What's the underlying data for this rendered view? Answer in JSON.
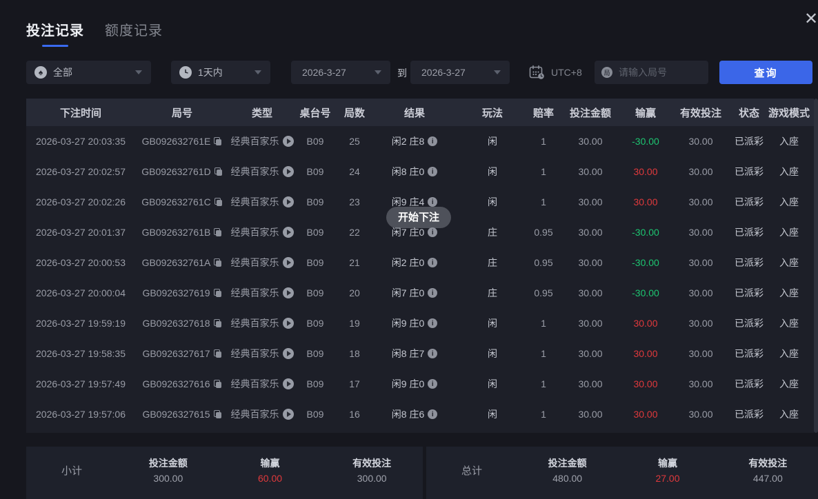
{
  "window": {
    "close_icon": "✕"
  },
  "tabs": [
    {
      "label": "投注记录",
      "active": true
    },
    {
      "label": "额度记录",
      "active": false
    }
  ],
  "filters": {
    "game_type": {
      "value": "全部",
      "icon_glyph": "♠"
    },
    "time_range": {
      "value": "1天内"
    },
    "date_from": "2026-3-27",
    "to_label": "到",
    "date_to": "2026-3-27",
    "timezone": "UTC+8",
    "round_placeholder": "请输入局号",
    "round_icon_label": "局",
    "query_label": "查询"
  },
  "table": {
    "headers": [
      "下注时间",
      "局号",
      "类型",
      "桌台号",
      "局数",
      "结果",
      "玩法",
      "赔率",
      "投注金额",
      "输赢",
      "有效投注",
      "状态",
      "游戏模式"
    ],
    "rows": [
      {
        "time": "2026-03-27 20:03:35",
        "round_id": "GB092632761E",
        "type": "经典百家乐",
        "table_no": "B09",
        "round": "25",
        "result": "闲2 庄8",
        "play": "闲",
        "odds": "1",
        "bet": "30.00",
        "winloss": "-30.00",
        "valid": "30.00",
        "status": "已派彩",
        "mode": "入座"
      },
      {
        "time": "2026-03-27 20:02:57",
        "round_id": "GB092632761D",
        "type": "经典百家乐",
        "table_no": "B09",
        "round": "24",
        "result": "闲8 庄0",
        "play": "闲",
        "odds": "1",
        "bet": "30.00",
        "winloss": "30.00",
        "valid": "30.00",
        "status": "已派彩",
        "mode": "入座"
      },
      {
        "time": "2026-03-27 20:02:26",
        "round_id": "GB092632761C",
        "type": "经典百家乐",
        "table_no": "B09",
        "round": "23",
        "result": "闲9 庄4",
        "play": "闲",
        "odds": "1",
        "bet": "30.00",
        "winloss": "30.00",
        "valid": "30.00",
        "status": "已派彩",
        "mode": "入座"
      },
      {
        "time": "2026-03-27 20:01:37",
        "round_id": "GB092632761B",
        "type": "经典百家乐",
        "table_no": "B09",
        "round": "22",
        "result": "闲7 庄0",
        "play": "庄",
        "odds": "0.95",
        "bet": "30.00",
        "winloss": "-30.00",
        "valid": "30.00",
        "status": "已派彩",
        "mode": "入座"
      },
      {
        "time": "2026-03-27 20:00:53",
        "round_id": "GB092632761A",
        "type": "经典百家乐",
        "table_no": "B09",
        "round": "21",
        "result": "闲2 庄0",
        "play": "庄",
        "odds": "0.95",
        "bet": "30.00",
        "winloss": "-30.00",
        "valid": "30.00",
        "status": "已派彩",
        "mode": "入座"
      },
      {
        "time": "2026-03-27 20:00:04",
        "round_id": "GB0926327619",
        "type": "经典百家乐",
        "table_no": "B09",
        "round": "20",
        "result": "闲7 庄0",
        "play": "庄",
        "odds": "0.95",
        "bet": "30.00",
        "winloss": "-30.00",
        "valid": "30.00",
        "status": "已派彩",
        "mode": "入座"
      },
      {
        "time": "2026-03-27 19:59:19",
        "round_id": "GB0926327618",
        "type": "经典百家乐",
        "table_no": "B09",
        "round": "19",
        "result": "闲9 庄0",
        "play": "闲",
        "odds": "1",
        "bet": "30.00",
        "winloss": "30.00",
        "valid": "30.00",
        "status": "已派彩",
        "mode": "入座"
      },
      {
        "time": "2026-03-27 19:58:35",
        "round_id": "GB0926327617",
        "type": "经典百家乐",
        "table_no": "B09",
        "round": "18",
        "result": "闲8 庄7",
        "play": "闲",
        "odds": "1",
        "bet": "30.00",
        "winloss": "30.00",
        "valid": "30.00",
        "status": "已派彩",
        "mode": "入座"
      },
      {
        "time": "2026-03-27 19:57:49",
        "round_id": "GB0926327616",
        "type": "经典百家乐",
        "table_no": "B09",
        "round": "17",
        "result": "闲9 庄0",
        "play": "闲",
        "odds": "1",
        "bet": "30.00",
        "winloss": "30.00",
        "valid": "30.00",
        "status": "已派彩",
        "mode": "入座"
      },
      {
        "time": "2026-03-27 19:57:06",
        "round_id": "GB0926327615",
        "type": "经典百家乐",
        "table_no": "B09",
        "round": "16",
        "result": "闲8 庄6",
        "play": "闲",
        "odds": "1",
        "bet": "30.00",
        "winloss": "30.00",
        "valid": "30.00",
        "status": "已派彩",
        "mode": "入座"
      }
    ]
  },
  "toast": {
    "label": "开始下注"
  },
  "summary": {
    "subtotal": {
      "label": "小计",
      "items": [
        {
          "name": "投注金额",
          "value": "300.00",
          "color": "plain"
        },
        {
          "name": "输赢",
          "value": "60.00",
          "color": "red"
        },
        {
          "name": "有效投注",
          "value": "300.00",
          "color": "plain"
        }
      ]
    },
    "total": {
      "label": "总计",
      "items": [
        {
          "name": "投注金额",
          "value": "480.00",
          "color": "plain"
        },
        {
          "name": "输赢",
          "value": "27.00",
          "color": "red"
        },
        {
          "name": "有效投注",
          "value": "447.00",
          "color": "plain"
        }
      ]
    }
  },
  "colors": {
    "accent_blue": "#3b66e8",
    "win_red": "#e0393c",
    "loss_green": "#1dc470"
  }
}
